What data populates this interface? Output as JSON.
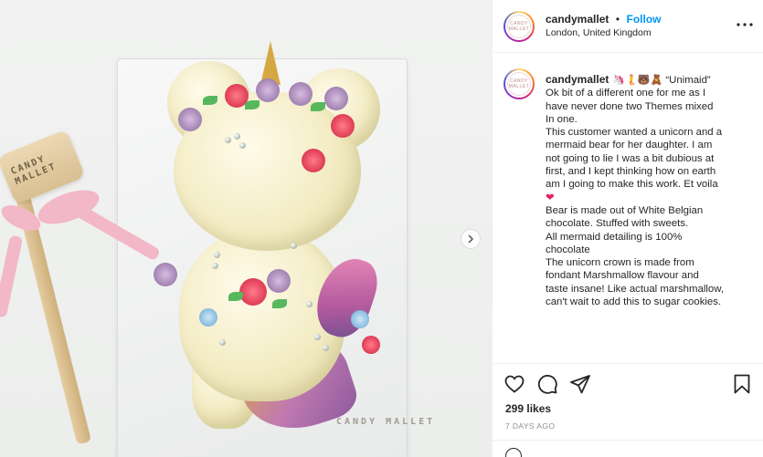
{
  "photo": {
    "hammer_brand": "CANDY MALLET",
    "board_brand": "CANDY MALLET",
    "next_icon": "chevron-right-icon"
  },
  "header": {
    "username": "candymallet",
    "separator": "•",
    "follow_label": "Follow",
    "location": "London, United Kingdom",
    "avatar_text": "CANDY MALLET",
    "more_icon": "ellipsis-icon"
  },
  "caption": {
    "username": "candymallet",
    "emojis": "🦄🧜🐻🧸",
    "title": "“Unimaid”",
    "lines": [
      "Ok bit of a different one for me as I",
      "have never done two Themes mixed",
      "In one.",
      "This customer wanted a unicorn and a",
      "mermaid bear for her daughter. I am",
      "not going to lie I was a bit dubious at",
      "first, and I kept thinking how on earth",
      "am I going to make this work. Et voila",
      "❤",
      "",
      "Bear is made out of White Belgian",
      "chocolate. Stuffed with sweets.",
      "All mermaid detailing is 100%",
      "chocolate",
      "The unicorn crown is made from",
      "fondant Marshmallow flavour and",
      "taste insane! Like actual marshmallow,",
      "can't wait to add this to sugar cookies."
    ]
  },
  "actions": {
    "like_icon": "heart-icon",
    "comment_icon": "comment-icon",
    "share_icon": "share-icon",
    "save_icon": "bookmark-icon"
  },
  "likes": "299 likes",
  "posted_ago": "7 DAYS AGO",
  "colors": {
    "link": "#0095f6",
    "text": "#262626",
    "muted": "#8e8e8e",
    "border": "#efefef"
  }
}
